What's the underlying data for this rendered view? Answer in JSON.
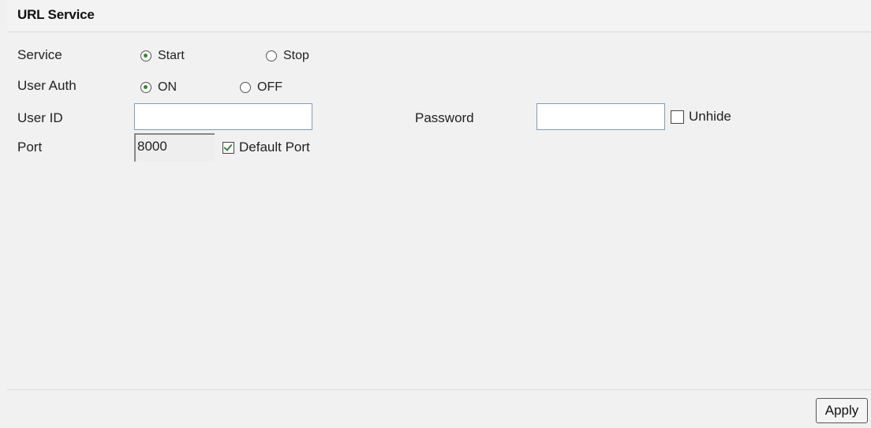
{
  "header": {
    "title": "URL Service"
  },
  "form": {
    "service": {
      "label": "Service",
      "options": [
        "Start",
        "Stop"
      ],
      "selected": "Start"
    },
    "user_auth": {
      "label": "User Auth",
      "options": [
        "ON",
        "OFF"
      ],
      "selected": "ON"
    },
    "user_id": {
      "label": "User ID",
      "value": ""
    },
    "password": {
      "label": "Password",
      "value": ""
    },
    "unhide": {
      "label": "Unhide",
      "checked": false
    },
    "port": {
      "label": "Port",
      "value": "8000"
    },
    "default_port": {
      "label": "Default Port",
      "checked": true
    }
  },
  "footer": {
    "apply_label": "Apply"
  },
  "colors": {
    "panel_bg": "#f1f1f1",
    "input_border": "#7f9db9",
    "check_mark": "#2e8b2e"
  }
}
